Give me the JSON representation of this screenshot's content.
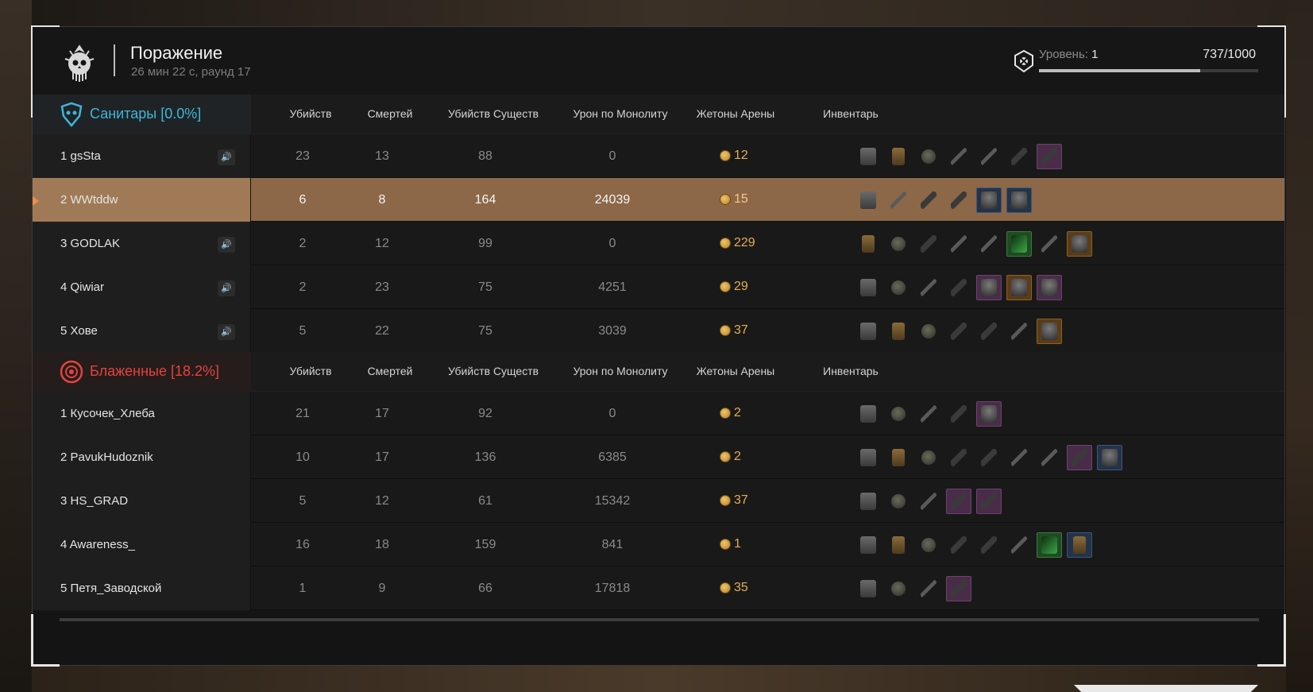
{
  "header": {
    "title": "Поражение",
    "subtitle": "26 мин 22 с, раунд 17",
    "level_label": "Уровень:",
    "level_value": "1",
    "xp_text": "737/1000",
    "xp_progress": 0.737
  },
  "columns": [
    "Убийств",
    "Смертей",
    "Убийств Существ",
    "Урон по Монолиту",
    "Жетоны Арены",
    "Инвентарь"
  ],
  "teams": [
    {
      "name": "Санитары [0.0%]",
      "color": "#3fb6d8",
      "icon": "sanitary-team-icon",
      "players": [
        {
          "rank_name": "1 gsSta",
          "kills": "23",
          "deaths": "13",
          "creature_kills": "88",
          "monolith_dmg": "0",
          "tokens": "12",
          "speaker": true,
          "highlight": false,
          "inventory": [
            "armor",
            "bag",
            "grenade",
            "knife",
            "knife",
            "gun",
            "purple:gun"
          ]
        },
        {
          "rank_name": "2 WWtddw",
          "kills": "6",
          "deaths": "8",
          "creature_kills": "164",
          "monolith_dmg": "24039",
          "tokens": "15",
          "speaker": false,
          "highlight": true,
          "inventory": [
            "armor",
            "knife",
            "gun",
            "gun",
            "blue:helm",
            "blue:helm"
          ]
        },
        {
          "rank_name": "3 GODLAK",
          "kills": "2",
          "deaths": "12",
          "creature_kills": "99",
          "monolith_dmg": "0",
          "tokens": "229",
          "speaker": true,
          "highlight": false,
          "inventory": [
            "bag",
            "grenade",
            "gun",
            "knife",
            "knife",
            "green:green",
            "knife",
            "orange:helm"
          ]
        },
        {
          "rank_name": "4 Qiwiar",
          "kills": "2",
          "deaths": "23",
          "creature_kills": "75",
          "monolith_dmg": "4251",
          "tokens": "29",
          "speaker": true,
          "highlight": false,
          "inventory": [
            "armor",
            "grenade",
            "knife",
            "gun",
            "purple:helm",
            "orange:helm",
            "purple:helm"
          ]
        },
        {
          "rank_name": "5 Хове",
          "kills": "5",
          "deaths": "22",
          "creature_kills": "75",
          "monolith_dmg": "3039",
          "tokens": "37",
          "speaker": true,
          "highlight": false,
          "inventory": [
            "armor",
            "bag",
            "grenade",
            "gun",
            "gun",
            "knife",
            "orange:helm"
          ]
        }
      ]
    },
    {
      "name": "Блаженные [18.2%]",
      "color": "#e3433d",
      "icon": "blessed-team-icon",
      "players": [
        {
          "rank_name": "1 Кусочек_Хлеба",
          "kills": "21",
          "deaths": "17",
          "creature_kills": "92",
          "monolith_dmg": "0",
          "tokens": "2",
          "speaker": false,
          "highlight": false,
          "inventory": [
            "armor",
            "grenade",
            "knife",
            "gun",
            "purple:helm"
          ]
        },
        {
          "rank_name": "2 PavukHudoznik",
          "kills": "10",
          "deaths": "17",
          "creature_kills": "136",
          "monolith_dmg": "6385",
          "tokens": "2",
          "speaker": false,
          "highlight": false,
          "inventory": [
            "armor",
            "bag",
            "grenade",
            "gun",
            "gun",
            "knife",
            "knife",
            "purple:gun",
            "blue:helm"
          ]
        },
        {
          "rank_name": "3 HS_GRAD",
          "kills": "5",
          "deaths": "12",
          "creature_kills": "61",
          "monolith_dmg": "15342",
          "tokens": "37",
          "speaker": false,
          "highlight": false,
          "inventory": [
            "armor",
            "grenade",
            "knife",
            "purple:gun",
            "purple:gun"
          ]
        },
        {
          "rank_name": "4 Awareness_",
          "kills": "16",
          "deaths": "18",
          "creature_kills": "159",
          "monolith_dmg": "841",
          "tokens": "1",
          "speaker": false,
          "highlight": false,
          "inventory": [
            "armor",
            "bag",
            "grenade",
            "gun",
            "gun",
            "knife",
            "green:green",
            "blue:bag"
          ]
        },
        {
          "rank_name": "5 Петя_Заводской",
          "kills": "1",
          "deaths": "9",
          "creature_kills": "66",
          "monolith_dmg": "17818",
          "tokens": "35",
          "speaker": false,
          "highlight": false,
          "inventory": [
            "armor",
            "grenade",
            "knife",
            "purple:gun"
          ]
        }
      ]
    }
  ]
}
